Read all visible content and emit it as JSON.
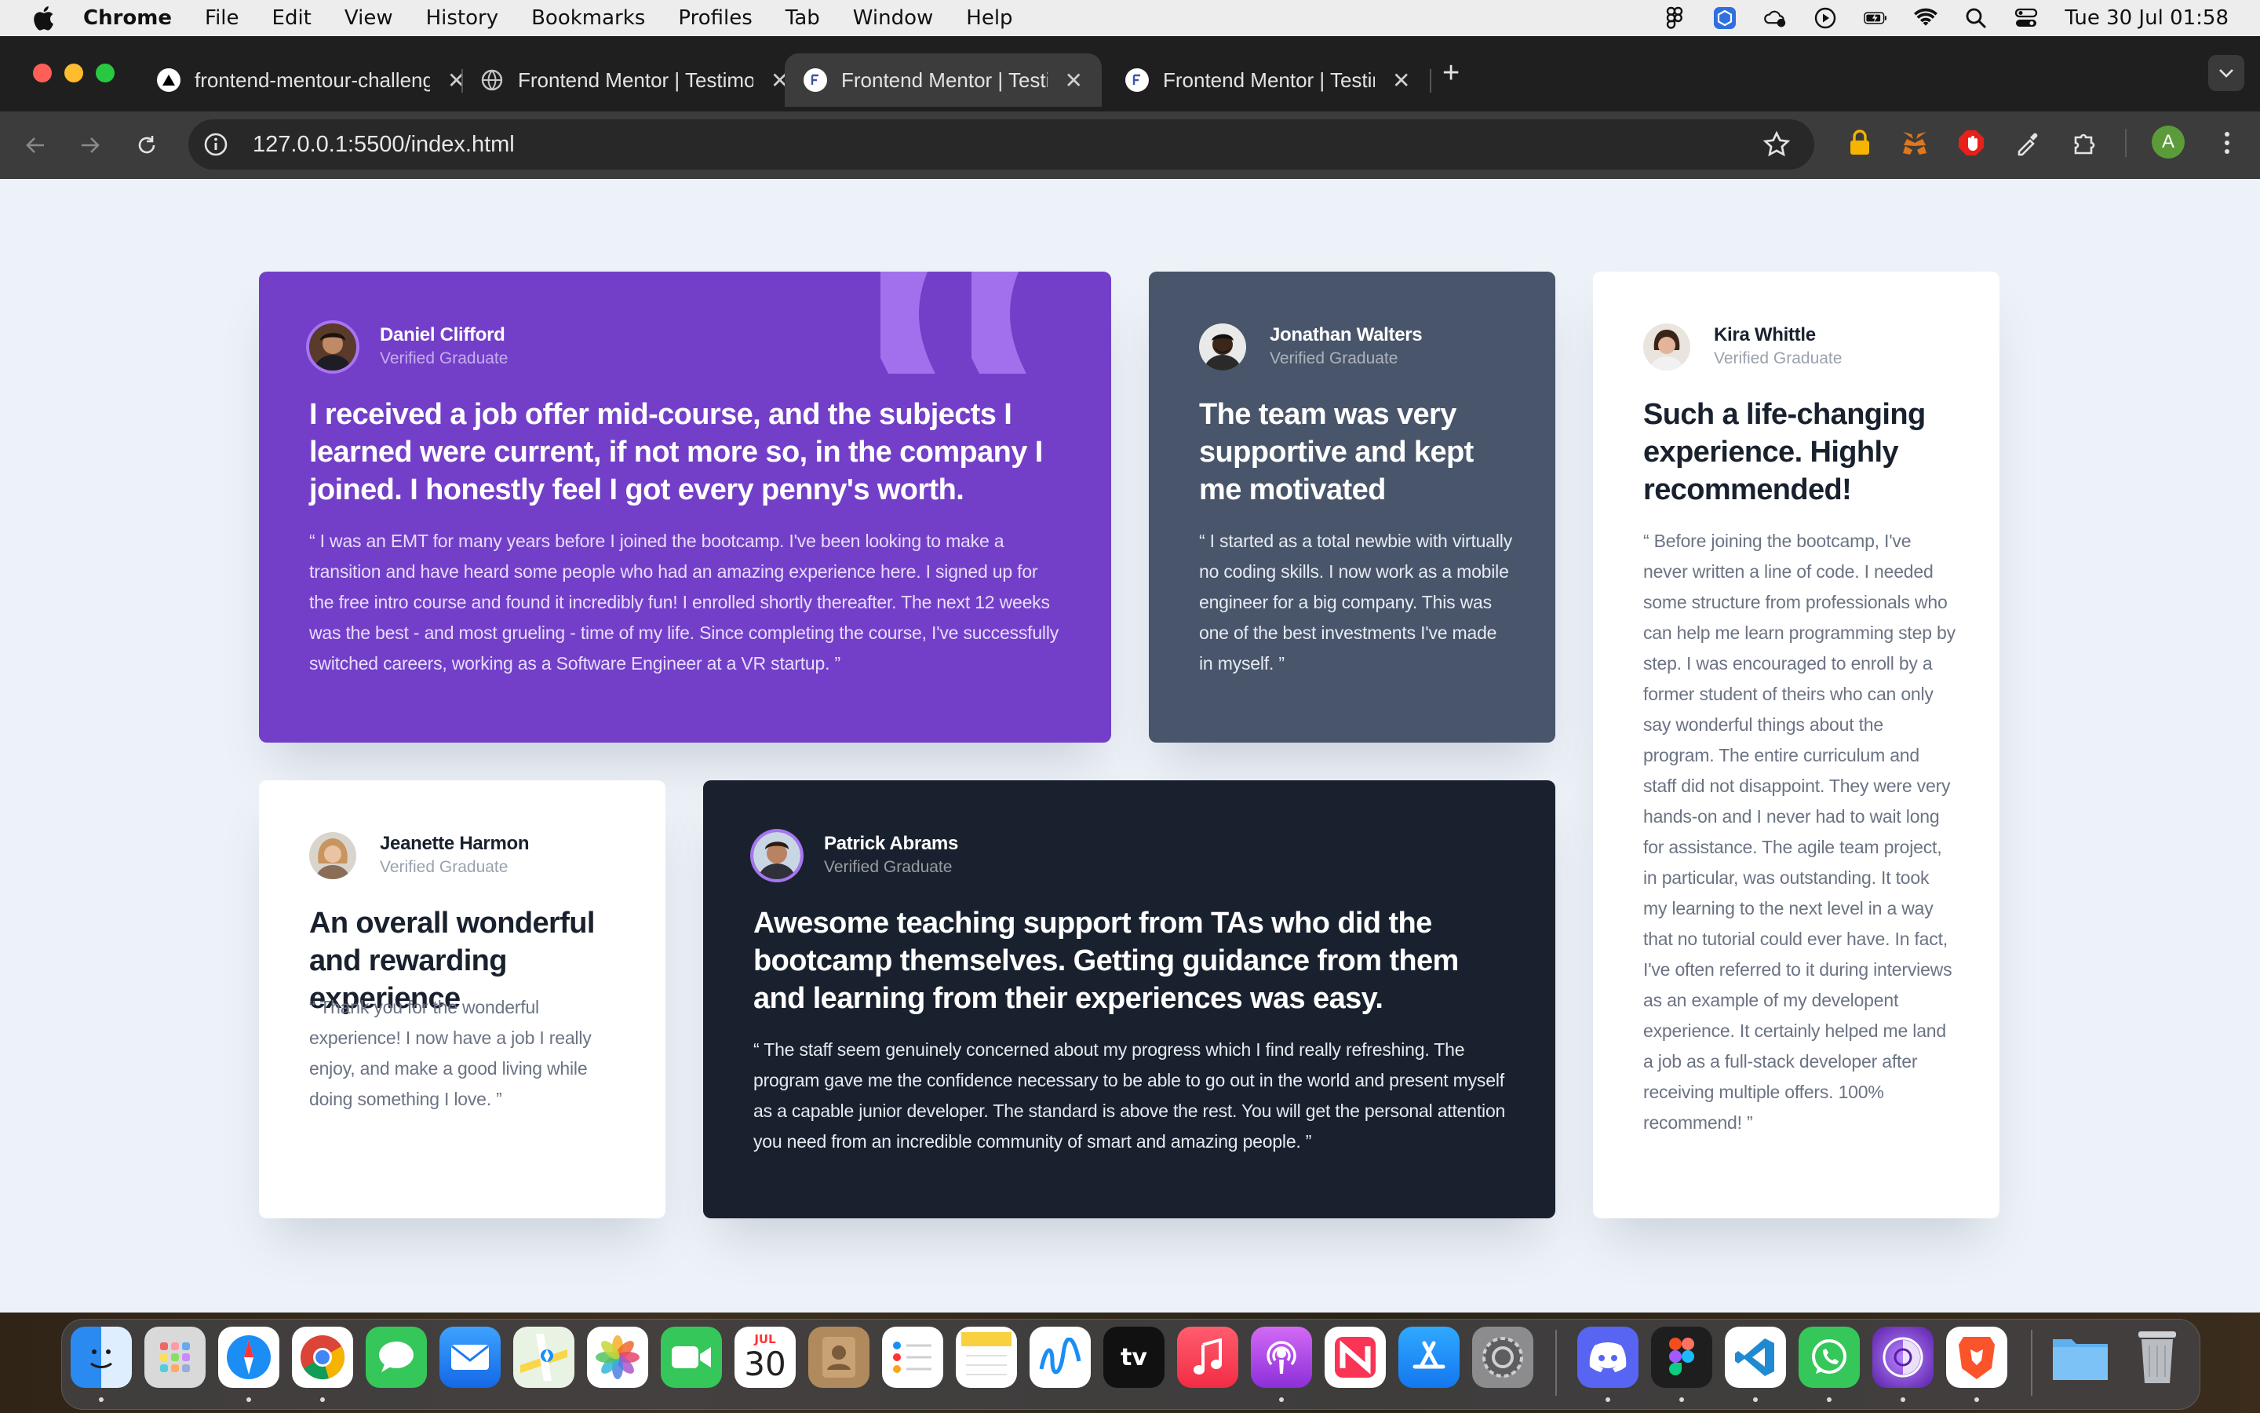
{
  "menubar": {
    "app": "Chrome",
    "items": [
      "File",
      "Edit",
      "View",
      "History",
      "Bookmarks",
      "Profiles",
      "Tab",
      "Window",
      "Help"
    ],
    "clock": "Tue 30 Jul  01:58"
  },
  "browser": {
    "tabs": [
      {
        "title": "frontend-mentour-challenge",
        "favicon": "vercel-icon"
      },
      {
        "title": "Frontend Mentor | Testimonials",
        "favicon": "globe-icon"
      },
      {
        "title": "Frontend Mentor | Testimonials",
        "favicon": "frontend-mentor-icon"
      },
      {
        "title": "Frontend Mentor | Testimonials",
        "favicon": "frontend-mentor-icon"
      }
    ],
    "url": "127.0.0.1:5500/index.html",
    "profile_initial": "A"
  },
  "testimonials": [
    {
      "name": "Daniel Clifford",
      "status": "Verified Graduate",
      "headline": "I received a job offer mid-course, and the subjects I learned were current, if not more so, in the company I joined. I honestly feel I got every penny's worth.",
      "quote": "“ I was an EMT for many years before I joined the bootcamp. I've been looking to make a transition and have heard some people who had an amazing experience here. I signed up for the free intro course and found it incredibly fun! I enrolled shortly thereafter. The next 12 weeks was the best - and most grueling - time of my life. Since completing the course, I've successfully switched careers, working as a Software Engineer at a VR startup. ”",
      "accent": "#733fc8"
    },
    {
      "name": "Jonathan Walters",
      "status": "Verified Graduate",
      "headline": "The team was very supportive and kept me motivated",
      "quote": "“ I started as a total newbie with virtually no coding skills. I now work as a mobile engineer for a big company. This was one of the best investments I've made in myself. ”",
      "accent": "#48556a"
    },
    {
      "name": "Kira Whittle",
      "status": "Verified Graduate",
      "headline": "Such a life-changing experience. Highly recommended!",
      "quote": "“ Before joining the bootcamp, I've never written a line of code. I needed some structure from professionals who can help me learn programming step by step. I was encouraged to enroll by a former student of theirs who can only say wonderful things about the program. The entire curriculum and staff did not disappoint. They were very hands-on and I never had to wait long for assistance. The agile team project, in particular, was outstanding. It took my learning to the next level in a way that no tutorial could ever have. In fact, I've often referred to it during interviews as an example of my developent experience. It certainly helped me land a job as a full-stack developer after receiving multiple offers. 100% recommend! ”",
      "accent": "#ffffff"
    },
    {
      "name": "Jeanette Harmon",
      "status": "Verified Graduate",
      "headline": "An overall wonderful and rewarding experience",
      "quote": "“ Thank you for the wonderful experience! I now have a job I really enjoy, and make a good living while doing something I love. ”",
      "accent": "#ffffff"
    },
    {
      "name": "Patrick Abrams",
      "status": "Verified Graduate",
      "headline": "Awesome teaching support from TAs who did the bootcamp themselves. Getting guidance from them and learning from their experiences was easy.",
      "quote": "“ The staff seem genuinely concerned about my progress which I find really refreshing. The program gave me the confidence necessary to be able to go out in the world and present myself as a capable junior developer. The standard is above the rest. You will get the personal attention you need from an incredible community of smart and amazing people. ”",
      "accent": "#19212e"
    }
  ],
  "dock": {
    "calendar_month": "JUL",
    "calendar_day": "30",
    "apps": [
      "finder-icon",
      "launchpad-icon",
      "safari-icon",
      "chrome-icon",
      "messages-icon",
      "mail-icon",
      "maps-icon",
      "photos-icon",
      "facetime-icon",
      "calendar-icon",
      "contacts-icon",
      "reminders-icon",
      "notes-icon",
      "freeform-icon",
      "apple-tv-icon",
      "music-icon",
      "podcasts-icon",
      "news-icon",
      "app-store-icon",
      "system-settings-icon",
      "discord-icon",
      "figma-icon",
      "vscode-icon",
      "whatsapp-icon",
      "tor-browser-icon",
      "brave-icon",
      "downloads-folder-icon",
      "trash-icon"
    ],
    "tv_label": "tv"
  }
}
